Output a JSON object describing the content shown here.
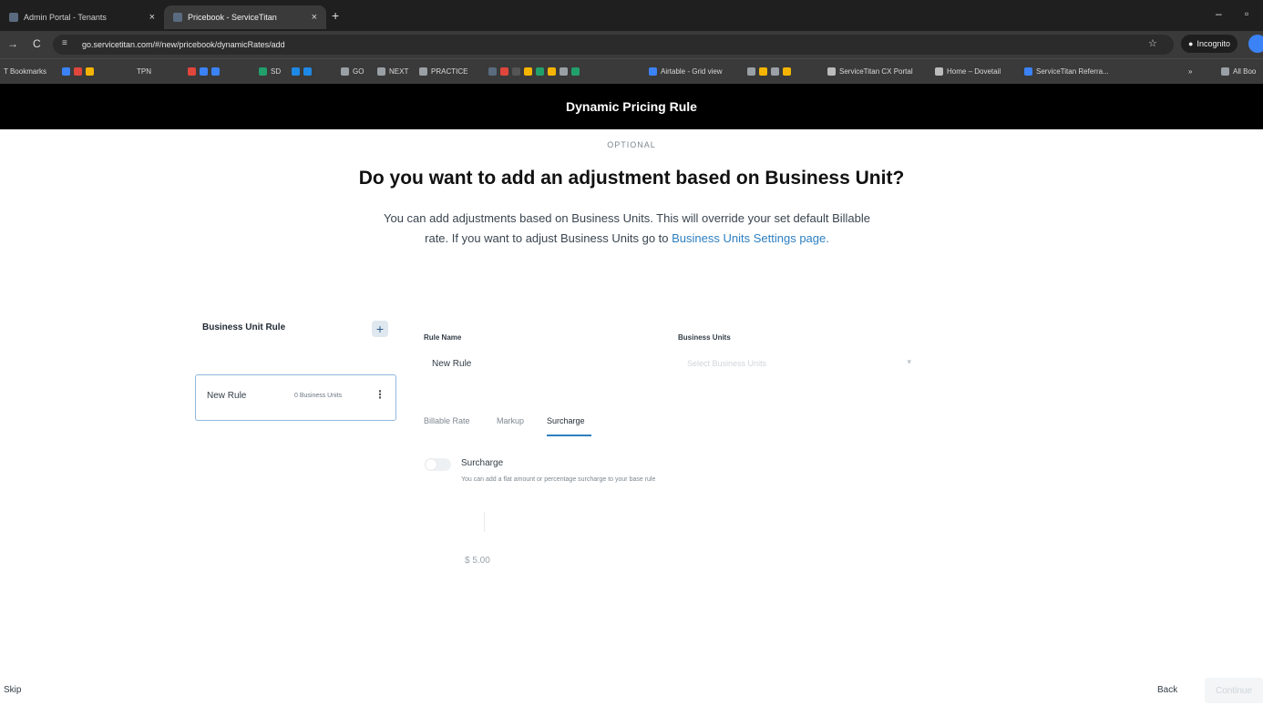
{
  "browser": {
    "tabs": [
      {
        "label": "Admin Portal - Tenants",
        "close": "×"
      },
      {
        "label": "Pricebook - ServiceTitan",
        "close": "×"
      }
    ],
    "new_tab": "+",
    "window_controls": {
      "minimize": "–"
    },
    "nav": {
      "forward": "→",
      "reload": "C"
    },
    "url": "go.servicetitan.com/#/new/pricebook/dynamicRates/add",
    "incognito_label": "Incognito",
    "bookmarks": [
      {
        "label": "T Bookmarks",
        "color": "#9aa0a6"
      },
      {
        "label": "TPN",
        "color": "#3b82f6"
      },
      {
        "label": "SD",
        "color": "#22a06b"
      },
      {
        "label": "GO",
        "color": "#9aa0a6"
      },
      {
        "label": "NEXT",
        "color": "#9aa0a6"
      },
      {
        "label": "PRACTICE",
        "color": "#9aa0a6"
      },
      {
        "label": "Airtable - Grid view",
        "color": "#3b82f6"
      },
      {
        "label": "ServiceTitan CX Portal",
        "color": "#bbbbbb"
      },
      {
        "label": "Home – Dovetail",
        "color": "#bbbbbb"
      },
      {
        "label": "ServiceTitan Referra...",
        "color": "#3b82f6"
      },
      {
        "label": "»",
        "color": ""
      },
      {
        "label": "All Boo",
        "color": "#9aa0a6"
      }
    ]
  },
  "header": {
    "title": "Dynamic Pricing Rule"
  },
  "main": {
    "optional_label": "OPTIONAL",
    "question": "Do you want to add an adjustment based on Business Unit?",
    "description": "You can add adjustments based on Business Units. This will override your set default Billable rate. If you want to adjust Business Units go to",
    "description_link": "Business Units Settings page.",
    "sidebar": {
      "title": "Business Unit Rule",
      "add_button": "+",
      "rule": {
        "name": "New Rule",
        "count": "0 Business Units",
        "menu": "⋮"
      }
    },
    "form": {
      "rule_name_label": "Rule Name",
      "rule_name_value": "New Rule",
      "business_units_label": "Business Units",
      "business_units_placeholder": "Select Business Units",
      "tabs": [
        "Billable Rate",
        "Markup",
        "Surcharge"
      ],
      "active_tab": "Surcharge",
      "surcharge_title": "Surcharge",
      "surcharge_help": "You can add a flat amount or percentage surcharge to your base rule",
      "amount_prefix": "$",
      "amount_value": "5.00"
    }
  },
  "footer": {
    "skip": "Skip",
    "back": "Back",
    "continue": "Continue"
  }
}
